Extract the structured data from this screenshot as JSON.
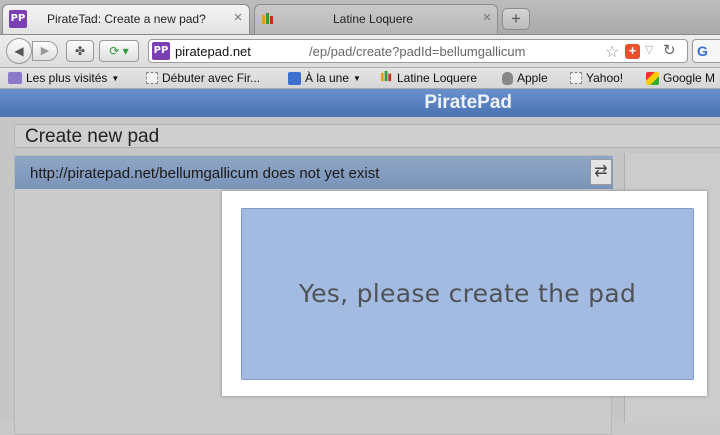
{
  "browser": {
    "tabs": [
      {
        "label": "PirateTad: Create a new pad?",
        "favicon": "PP",
        "active": true,
        "close": "×"
      },
      {
        "label": "Latine Loquere",
        "favicon": "wiki-icon",
        "active": false,
        "close": "×"
      }
    ],
    "new_tab_label": "+",
    "url_domain": "piratepad.net",
    "url_path": "/ep/pad/create?padId=bellumgallicum",
    "search_engine_label": "G",
    "bookmarks": [
      {
        "label": "Les plus visités",
        "icon": "most-visited-icon",
        "dropdown": true
      },
      {
        "label": "Débuter avec Fir...",
        "icon": "page-icon",
        "dropdown": false
      },
      {
        "label": "À la une",
        "icon": "rss-icon",
        "dropdown": true
      },
      {
        "label": "Latine Loquere",
        "icon": "wiki-icon",
        "dropdown": false
      },
      {
        "label": "Apple",
        "icon": "apple-icon",
        "dropdown": false
      },
      {
        "label": "Yahoo!",
        "icon": "page-icon",
        "dropdown": false
      },
      {
        "label": "Google M",
        "icon": "google-maps-icon",
        "dropdown": false
      }
    ]
  },
  "page": {
    "brand": "PiratePad",
    "create_heading": "Create new pad",
    "panel_message": "http://piratepad.net/bellumgallicum does not yet exist",
    "create_button_label": "Yes, please create the pad"
  },
  "colors": {
    "header_blue": "#4a72b2",
    "button_blue": "#a3bbe0",
    "favicon_purple": "#7a3fb0"
  }
}
